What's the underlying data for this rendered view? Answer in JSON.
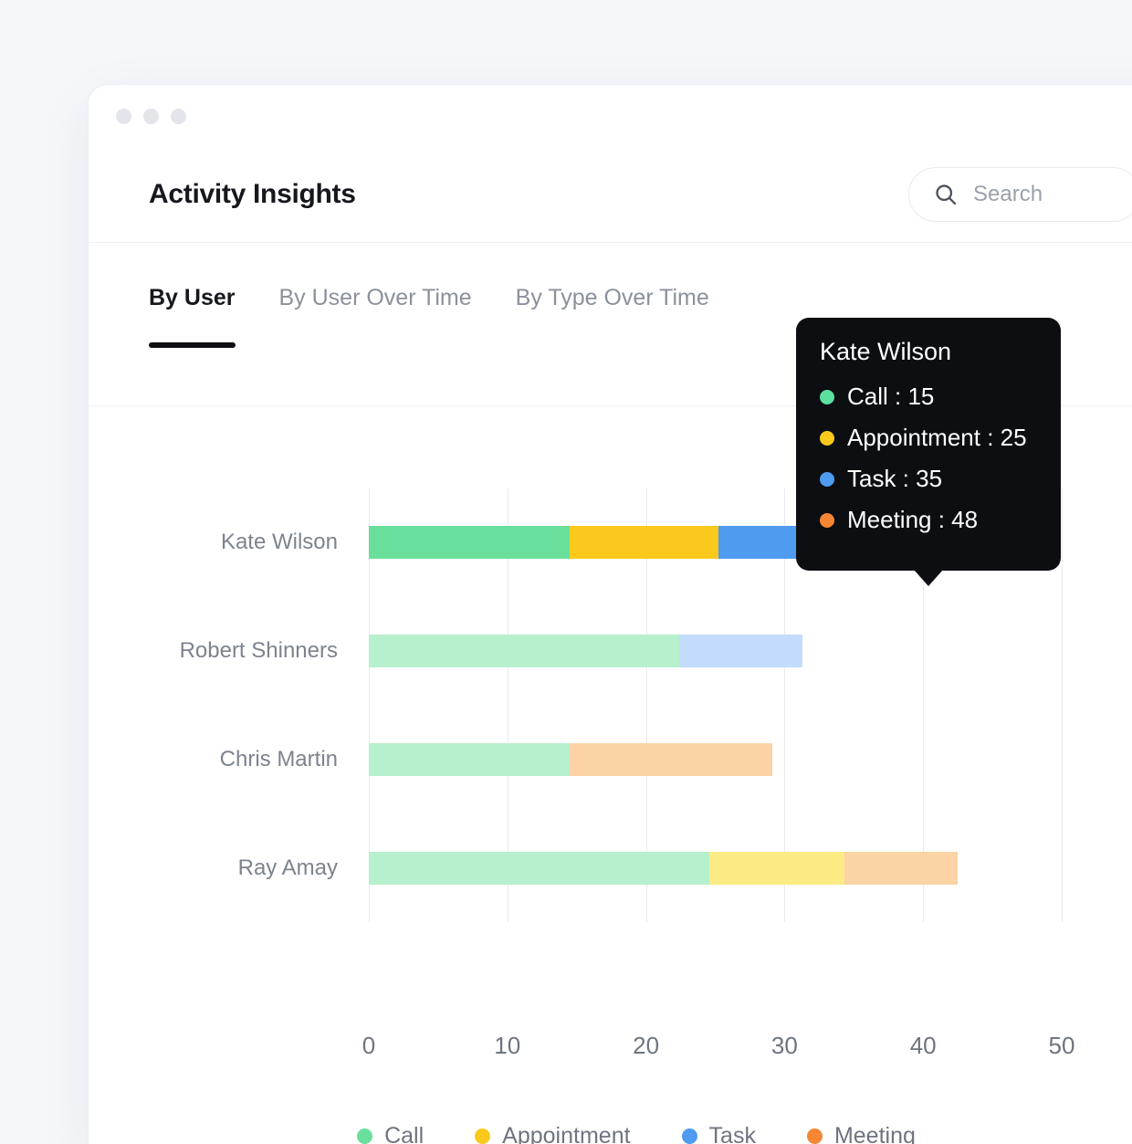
{
  "window": {
    "traffic_lights": [
      "close",
      "minimize",
      "maximize"
    ]
  },
  "header": {
    "title": "Activity Insights",
    "search": {
      "icon": "search-icon",
      "placeholder": "Search",
      "value": ""
    }
  },
  "tabs": [
    {
      "label": "By User",
      "active": true
    },
    {
      "label": "By User Over Time",
      "active": false
    },
    {
      "label": "By Type Over Time",
      "active": false
    }
  ],
  "tooltip": {
    "title": "Kate Wilson",
    "rows": [
      {
        "label": "Call",
        "value": "15",
        "text": "Call : 15",
        "color": "#5ce0a0"
      },
      {
        "label": "Appointment",
        "value": "25",
        "text": "Appointment : 25",
        "color": "#fbc91b"
      },
      {
        "label": "Task",
        "value": "35",
        "text": "Task : 35",
        "color": "#4e9bf0"
      },
      {
        "label": "Meeting",
        "value": "48",
        "text": "Meeting : 48",
        "color": "#f58634"
      }
    ]
  },
  "legend": [
    {
      "label": "Call",
      "color": "#6adf9b"
    },
    {
      "label": "Appointment",
      "color": "#fbc91b"
    },
    {
      "label": "Task",
      "color": "#4e9bf0"
    },
    {
      "label": "Meeting",
      "color": "#f58634"
    }
  ],
  "chart_data": {
    "type": "bar",
    "orientation": "horizontal",
    "stacked": true,
    "title": "",
    "xlabel": "",
    "ylabel": "",
    "xlim": [
      0,
      50
    ],
    "xticks": [
      "0",
      "10",
      "20",
      "30",
      "40",
      "50"
    ],
    "xtick_values": [
      0,
      10,
      20,
      30,
      40,
      50
    ],
    "grid": true,
    "legend_position": "bottom",
    "categories": [
      "Kate Wilson",
      "Robert Shinners",
      "Chris Martin",
      "Ray Amay"
    ],
    "series": [
      {
        "name": "Call",
        "color": "#6adf9b",
        "values": [
          15,
          22.5,
          14.5,
          24.5
        ]
      },
      {
        "name": "Appointment",
        "color": "#fbc91b",
        "values": [
          10.5,
          0,
          0,
          10
        ]
      },
      {
        "name": "Task",
        "color": "#4e9bf0",
        "values": [
          8.5,
          9,
          0,
          0
        ]
      },
      {
        "name": "Meeting",
        "color": "#f58634",
        "values": [
          14.5,
          0,
          14.5,
          8.5
        ]
      }
    ],
    "rows": [
      {
        "label": "Kate Wilson",
        "highlighted": true,
        "cumulative": [
          15,
          25,
          35,
          48
        ],
        "segments": [
          {
            "name": "Call",
            "start": 0,
            "end": 14.5,
            "color": "#6adf9b"
          },
          {
            "name": "Appointment",
            "start": 14.5,
            "end": 25.2,
            "color": "#fbc91b"
          },
          {
            "name": "Task",
            "start": 25.2,
            "end": 33.8,
            "color": "#4e9bf0"
          },
          {
            "name": "Meeting",
            "start": 33.8,
            "end": 48.3,
            "color": "#f58634"
          }
        ]
      },
      {
        "label": "Robert Shinners",
        "highlighted": false,
        "segments": [
          {
            "name": "Call",
            "start": 0,
            "end": 22.4,
            "color": "#b7f0cd"
          },
          {
            "name": "Task",
            "start": 22.4,
            "end": 31.3,
            "color": "#c3dcfb"
          }
        ]
      },
      {
        "label": "Chris Martin",
        "highlighted": false,
        "segments": [
          {
            "name": "Call",
            "start": 0,
            "end": 14.5,
            "color": "#b7f0cd"
          },
          {
            "name": "Meeting",
            "start": 14.5,
            "end": 29.1,
            "color": "#fbd3a5"
          }
        ]
      },
      {
        "label": "Ray Amay",
        "highlighted": false,
        "segments": [
          {
            "name": "Call",
            "start": 0,
            "end": 24.6,
            "color": "#b7f0cd"
          },
          {
            "name": "Appointment",
            "start": 24.6,
            "end": 34.3,
            "color": "#fbeb84"
          },
          {
            "name": "Meeting",
            "start": 34.3,
            "end": 42.5,
            "color": "#fbd3a5"
          }
        ]
      }
    ]
  }
}
